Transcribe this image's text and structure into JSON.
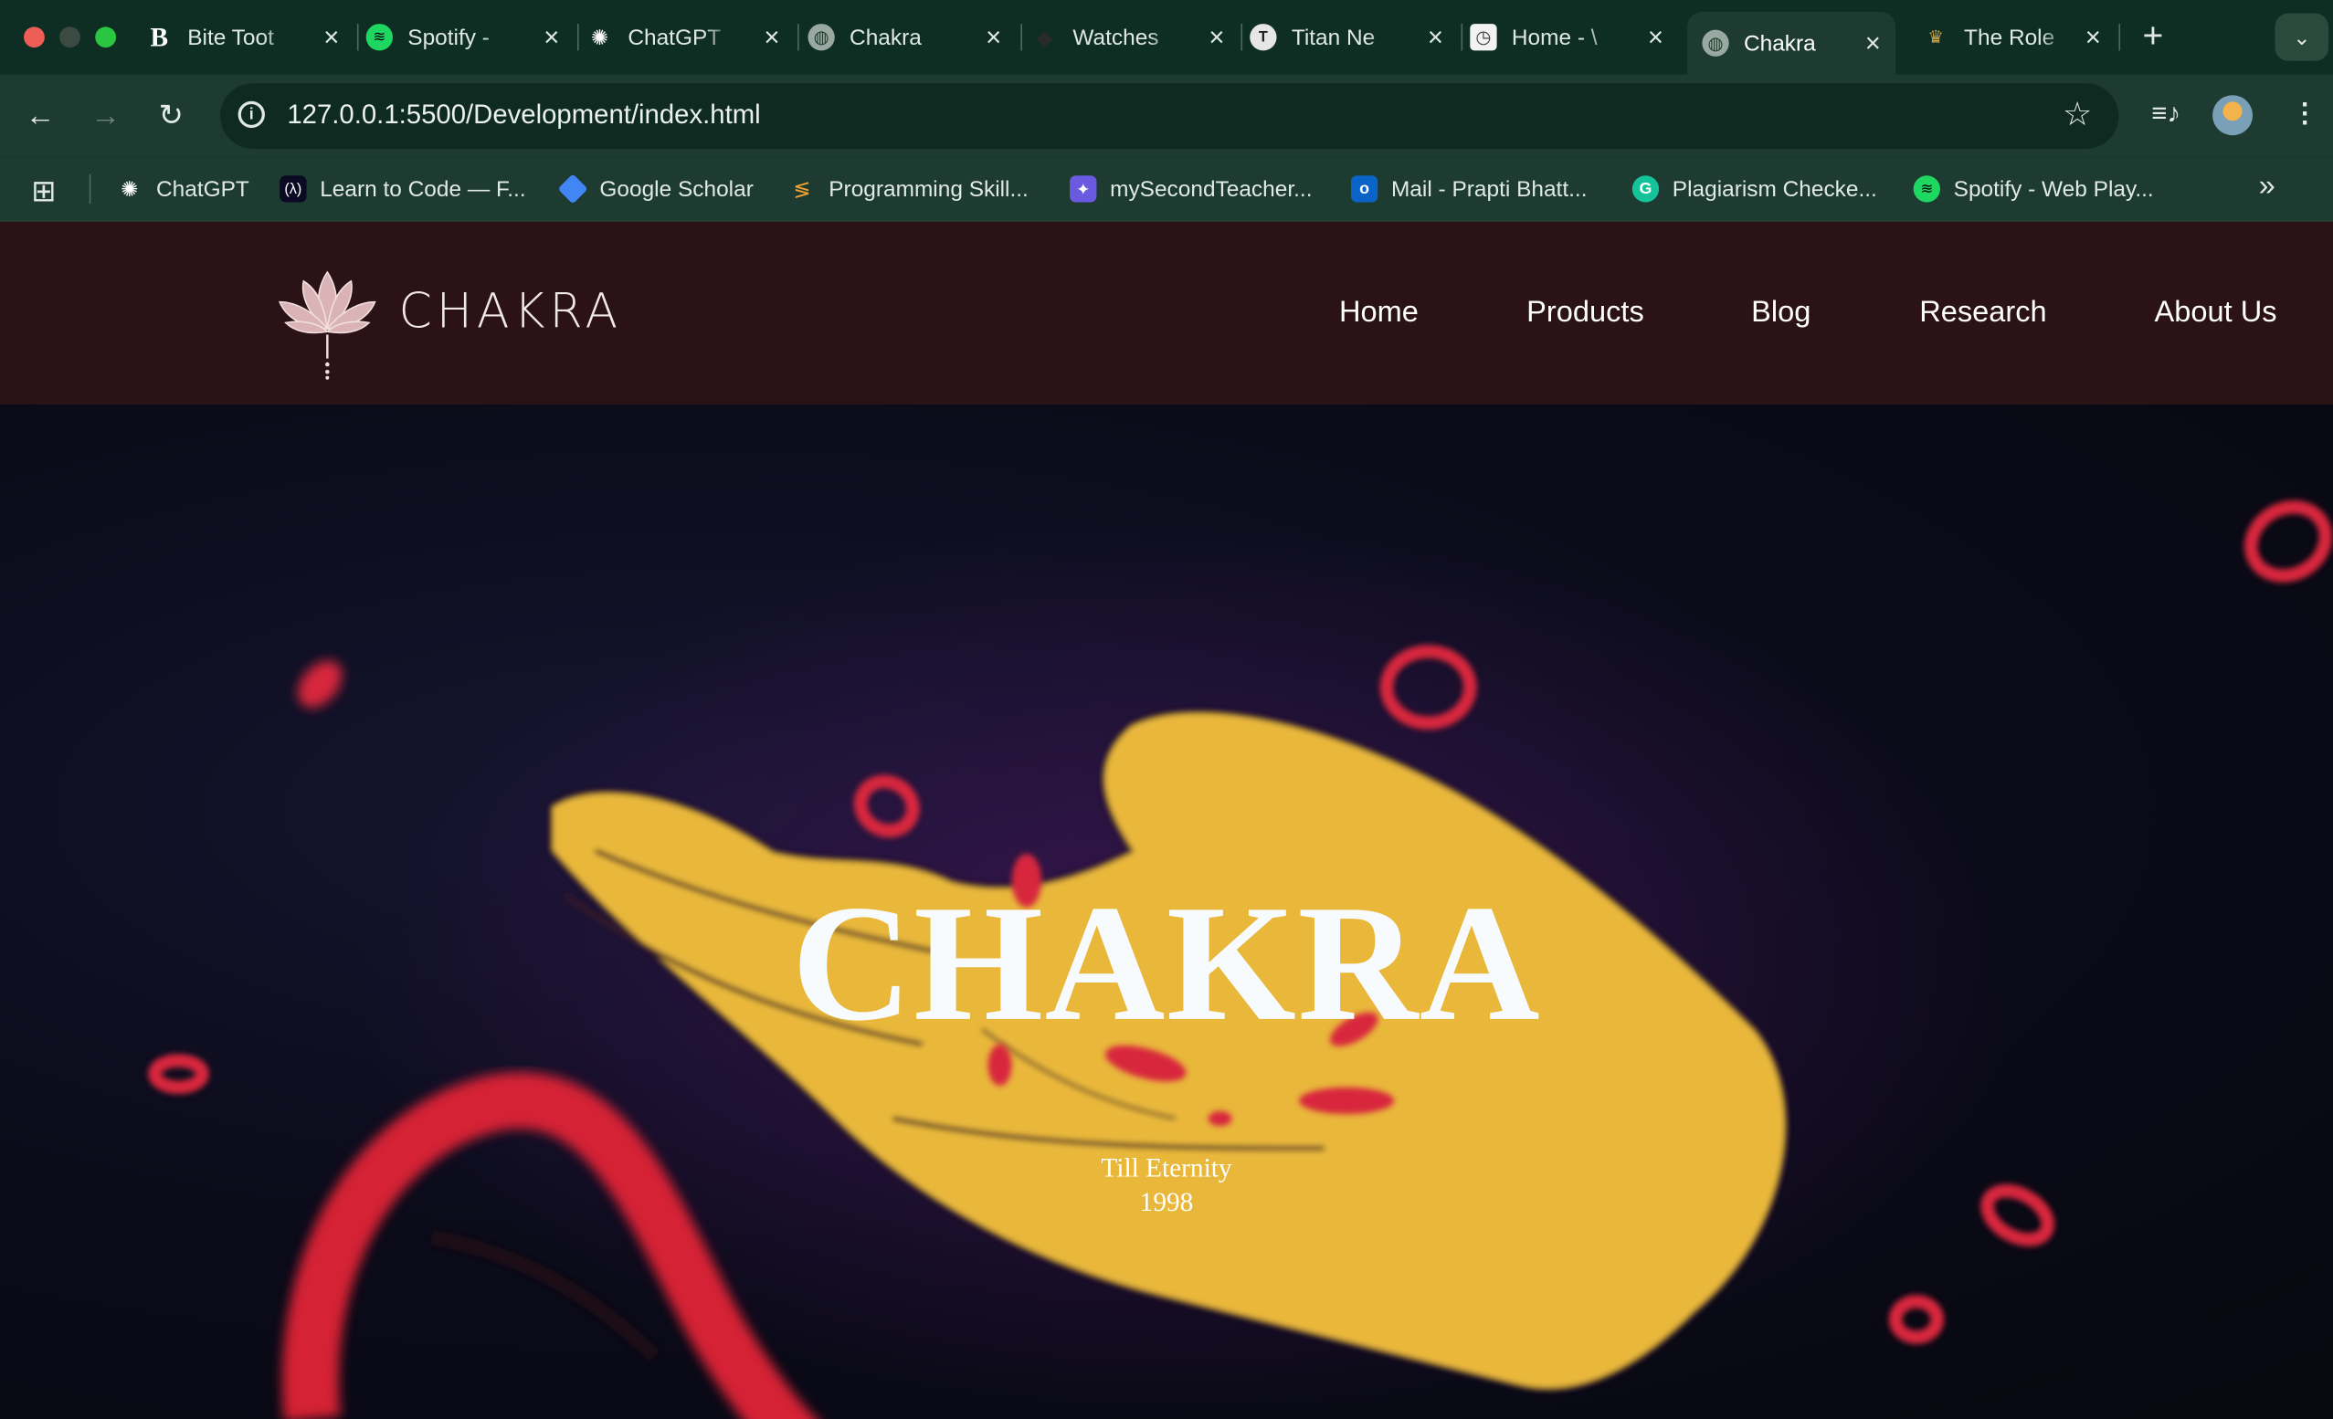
{
  "browser": {
    "tabs": [
      {
        "title": "Bite Toot",
        "favicon": "bold-b-icon"
      },
      {
        "title": "Spotify -",
        "favicon": "spotify-icon"
      },
      {
        "title": "ChatGPT",
        "favicon": "chatgpt-icon"
      },
      {
        "title": "Chakra",
        "favicon": "globe-icon"
      },
      {
        "title": "Watches",
        "favicon": "blank-icon"
      },
      {
        "title": "Titan Ne",
        "favicon": "titan-icon"
      },
      {
        "title": "Home - \\",
        "favicon": "clock-icon"
      },
      {
        "title": "Chakra",
        "favicon": "globe-icon",
        "active": true
      },
      {
        "title": "The Role",
        "favicon": "crown-icon"
      }
    ],
    "url": "127.0.0.1:5500/Development/index.html",
    "bookmarks": [
      {
        "label": "ChatGPT",
        "icon": "chatgpt-icon"
      },
      {
        "label": "Learn to Code — F...",
        "icon": "freecodecamp-icon"
      },
      {
        "label": "Google Scholar",
        "icon": "google-scholar-icon"
      },
      {
        "label": "Programming Skill...",
        "icon": "programming-icon"
      },
      {
        "label": "mySecondTeacher...",
        "icon": "mysecondteacher-icon"
      },
      {
        "label": "Mail - Prapti Bhatt...",
        "icon": "outlook-icon"
      },
      {
        "label": "Plagiarism Checke...",
        "icon": "grammarly-icon"
      },
      {
        "label": "Spotify - Web Play...",
        "icon": "spotify-icon"
      }
    ]
  },
  "site": {
    "logo_text": "CHAKRA",
    "nav": [
      "Home",
      "Products",
      "Blog",
      "Research",
      "About Us"
    ],
    "hero": {
      "title": "CHAKRA",
      "subtitle_line1": "Till Eternity",
      "subtitle_line2": "1998"
    }
  },
  "colors": {
    "tabstrip": "#0f2e23",
    "toolbar": "#1d3b30",
    "site_header": "#2a1216",
    "hand_yellow": "#e8b636",
    "petal_red": "#d8283c"
  }
}
